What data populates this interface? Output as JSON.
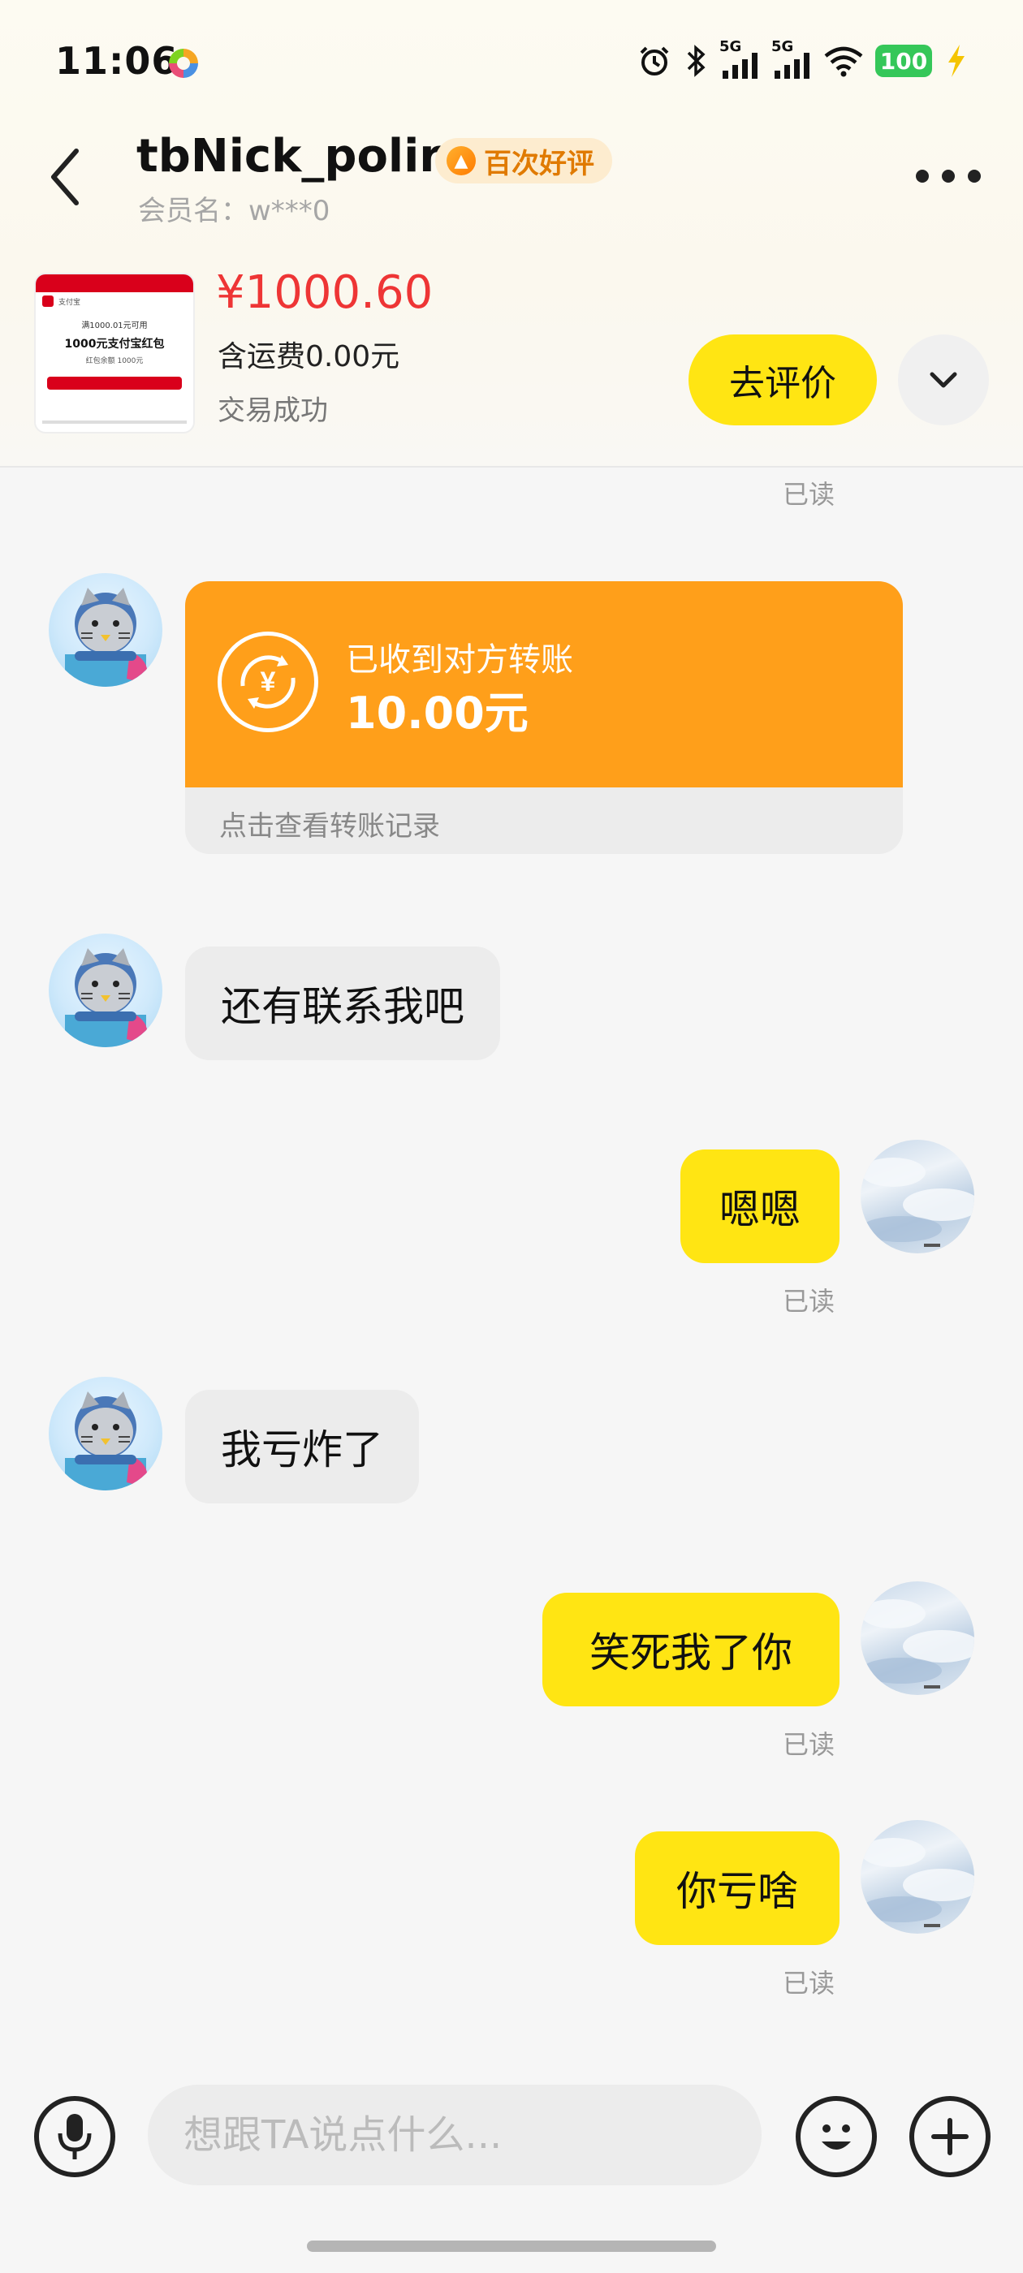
{
  "status_bar": {
    "time": "11:06",
    "signal_1": "5G",
    "signal_2": "5G",
    "battery": "100"
  },
  "header": {
    "nickname": "tbNick_polir",
    "badge": "百次好评",
    "member_label": "会员名：w***0"
  },
  "order": {
    "thumb": {
      "app": "支付宝",
      "line1": "满1000.01元可用",
      "line2": "1000元支付宝红包",
      "line3": "红包余额 1000元"
    },
    "price": "¥1000.60",
    "shipping": "含运费0.00元",
    "status": "交易成功",
    "review_button": "去评价"
  },
  "chat": {
    "read_label": "已读",
    "transfer": {
      "label": "已收到对方转账",
      "amount": "10.00元",
      "footer": "点击查看转账记录"
    },
    "messages": [
      {
        "from": "other",
        "text": "还有联系我吧"
      },
      {
        "from": "me",
        "text": "嗯嗯"
      },
      {
        "from": "other",
        "text": "我亏炸了"
      },
      {
        "from": "me",
        "text": "笑死我了你"
      },
      {
        "from": "me",
        "text": "你亏啥"
      }
    ]
  },
  "input_bar": {
    "placeholder": "想跟TA说点什么..."
  },
  "colors": {
    "accent_yellow": "#ffe513",
    "transfer_orange": "#ff9f1a",
    "price_red": "#ee3535"
  }
}
